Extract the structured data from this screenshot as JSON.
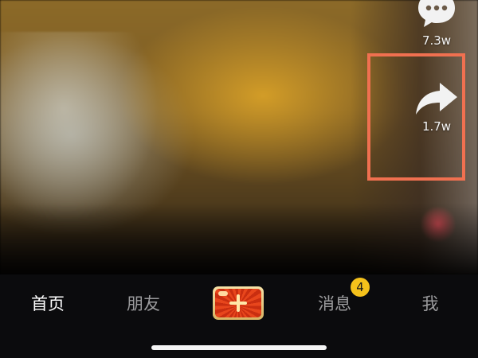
{
  "side_actions": {
    "comment": {
      "count": "7.3w",
      "icon": "comment-bubble-icon"
    },
    "share": {
      "count": "1.7w",
      "icon": "share-arrow-icon"
    }
  },
  "tabbar": {
    "tabs": [
      {
        "label": "首页",
        "active": true
      },
      {
        "label": "朋友",
        "active": false
      },
      {
        "label": "消息",
        "active": false,
        "badge": "4"
      },
      {
        "label": "我",
        "active": false
      }
    ],
    "create_icon": "plus-icon"
  },
  "colors": {
    "highlight": "#f07050",
    "badge": "#f5c21b",
    "tabbar_bg": "#0b0b0d",
    "create_red": "#e8461c"
  }
}
